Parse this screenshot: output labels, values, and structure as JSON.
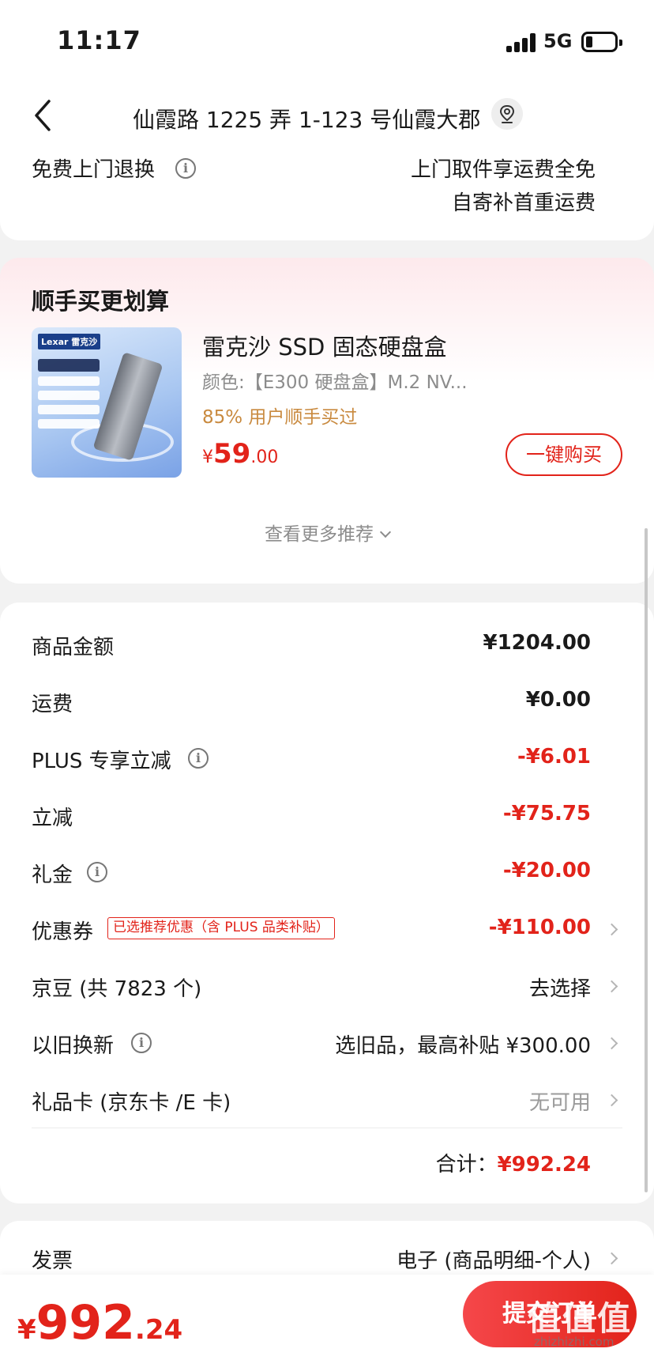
{
  "status_bar": {
    "time": "11:17",
    "network": "5G"
  },
  "header": {
    "address": "仙霞路 1225 弄 1-123 号仙霞大郡"
  },
  "return_policy": {
    "label": "免费上门退换",
    "note_line1": "上门取件享运费全免",
    "note_line2": "自寄补首重运费"
  },
  "recommend": {
    "title": "顺手买更划算",
    "product": {
      "name": "雷克沙 SSD 固态硬盘盒",
      "spec": "颜色:【E300 硬盘盒】M.2 NV...",
      "social_proof": "85% 用户顺手买过",
      "price_currency": "¥",
      "price_int": "59",
      "price_dec": ".00",
      "buy_label": "一键购买",
      "thumb_brand": "Lexar 雷克沙"
    },
    "more_label": "查看更多推荐"
  },
  "summary": {
    "rows": [
      {
        "label": "商品金额",
        "value": "¥1204.00"
      },
      {
        "label": "运费",
        "value": "¥0.00"
      },
      {
        "label": "PLUS 专享立减",
        "value": "-¥6.01"
      },
      {
        "label": "立减",
        "value": "-¥75.75"
      },
      {
        "label": "礼金",
        "value": "-¥20.00"
      },
      {
        "label": "优惠券",
        "tag": "已选推荐优惠（含 PLUS 品类补贴）",
        "value": "-¥110.00"
      },
      {
        "label": "京豆 (共 7823 个)",
        "value": "去选择"
      },
      {
        "label": "以旧换新",
        "value": "选旧品，最高补贴 ¥300.00"
      },
      {
        "label": "礼品卡 (京东卡 /E 卡)",
        "value": "无可用"
      }
    ],
    "total_label": "合计：",
    "total_value": "¥992.24"
  },
  "invoice": {
    "label": "发票",
    "value": "电子 (商品明细-个人)"
  },
  "bottom": {
    "currency": "¥",
    "amount_int": "992",
    "amount_dec": ".24",
    "submit_label": "提交订单",
    "watermark": "值值值",
    "watermark_url": "zhizhizhi.com"
  },
  "colors": {
    "accent": "#e2231a",
    "social": "#c98a3f",
    "muted": "#8c8c8c"
  }
}
